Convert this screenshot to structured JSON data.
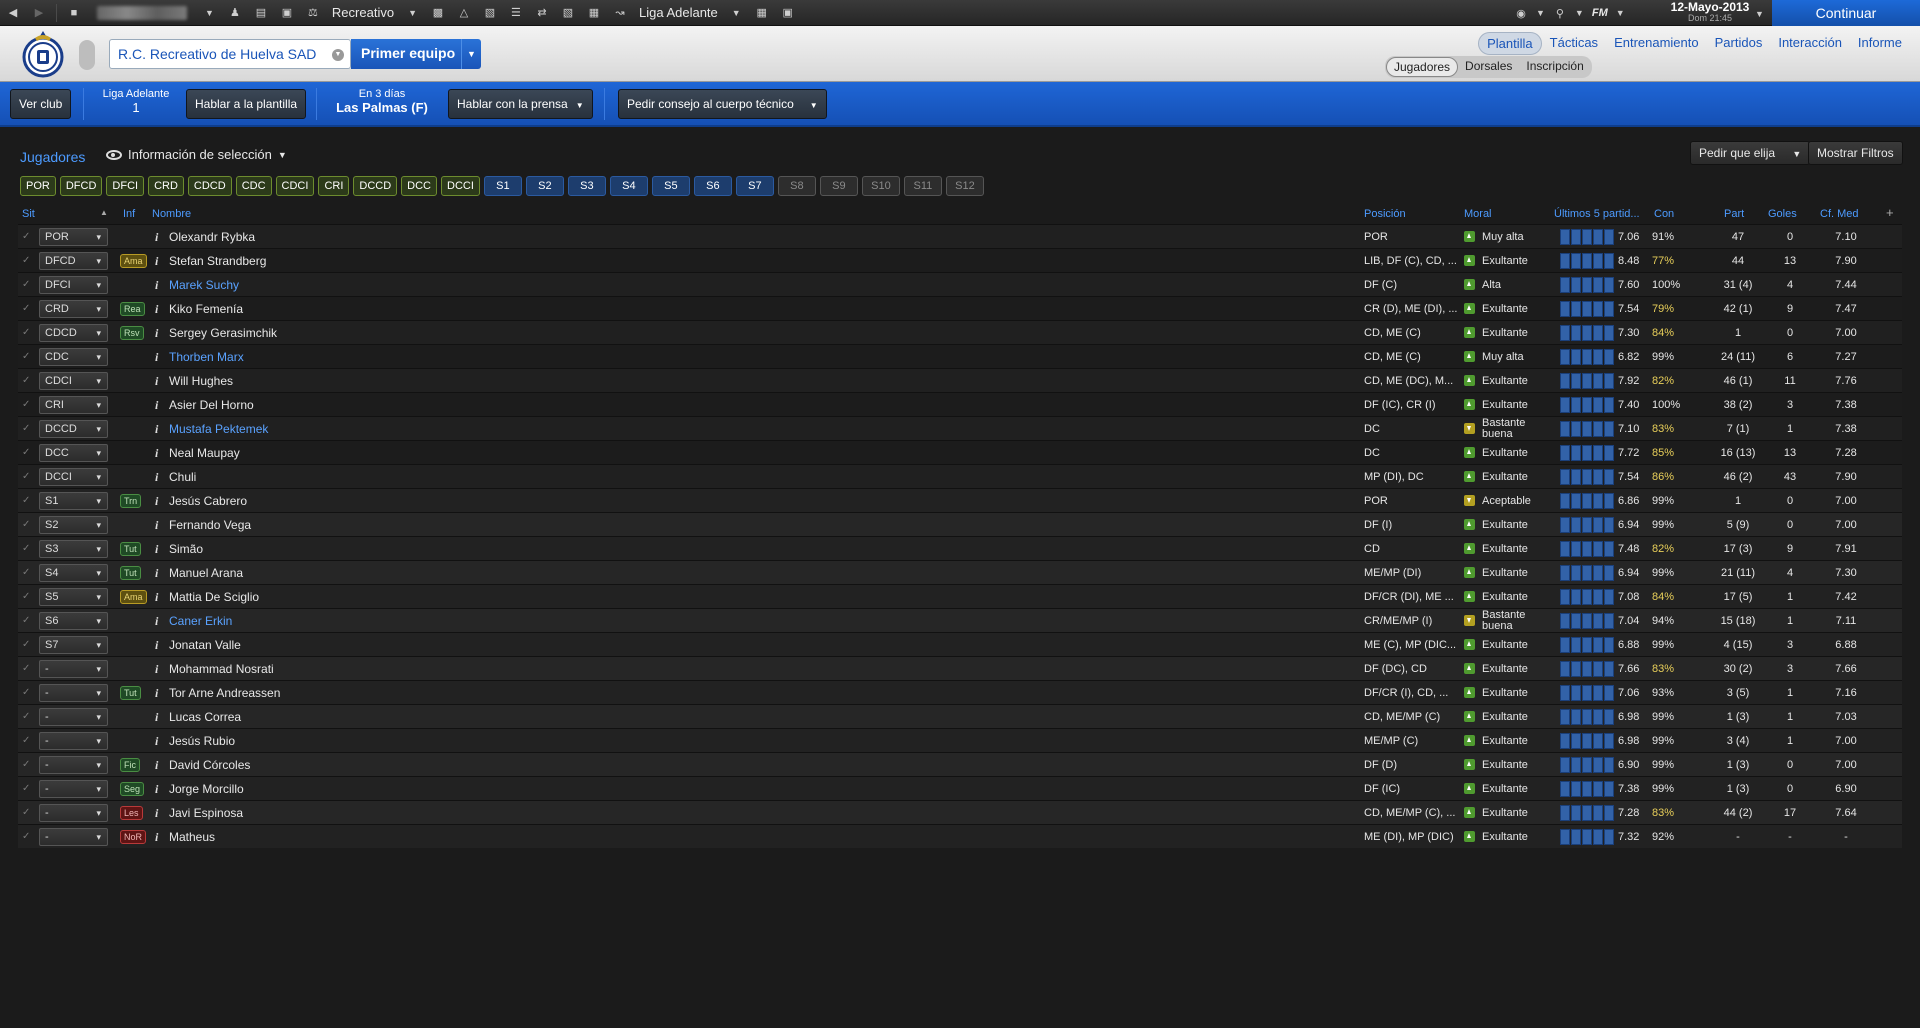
{
  "topbar": {
    "team_short": "Recreativo",
    "league": "Liga Adelante",
    "date": "12-Mayo-2013",
    "day_time": "Dom 21:45",
    "fm_label": "FM",
    "continue_label": "Continuar"
  },
  "header": {
    "club_name": "R.C. Recreativo de Huelva SAD",
    "team_button": "Primer equipo",
    "main_tabs": [
      "Plantilla",
      "Tácticas",
      "Entrenamiento",
      "Partidos",
      "Interacción",
      "Informe"
    ],
    "sub_tabs": [
      "Jugadores",
      "Dorsales",
      "Inscripción"
    ]
  },
  "actionbar": {
    "ver_club": "Ver club",
    "league_label": "Liga Adelante",
    "league_pos": "1",
    "talk_squad": "Hablar a la plantilla",
    "next_in": "En 3 días",
    "next_match": "Las Palmas (F)",
    "talk_press": "Hablar con la prensa",
    "ask_staff": "Pedir consejo al cuerpo técnico"
  },
  "panel": {
    "title": "Jugadores",
    "view": "Información de selección",
    "ask_choose": "Pedir que elija",
    "show_filters": "Mostrar Filtros"
  },
  "chips": {
    "positions": [
      "POR",
      "DFCD",
      "DFCI",
      "CRD",
      "CDCD",
      "CDC",
      "CDCI",
      "CRI",
      "DCCD",
      "DCC",
      "DCCI"
    ],
    "subs_active": [
      "S1",
      "S2",
      "S3",
      "S4",
      "S5",
      "S6",
      "S7"
    ],
    "subs_inactive": [
      "S8",
      "S9",
      "S10",
      "S11",
      "S12"
    ]
  },
  "columns": {
    "sit": "Sit",
    "inf": "Inf",
    "nombre": "Nombre",
    "posicion": "Posición",
    "moral": "Moral",
    "ultimos": "Últimos 5 partid...",
    "con": "Con",
    "part": "Part",
    "goles": "Goles",
    "cfmed": "Cf. Med",
    "add": "+"
  },
  "players": [
    {
      "sel": "POR",
      "inf": "",
      "name": "Olexandr Rybka",
      "link": false,
      "pos": "POR",
      "moral": "Muy alta",
      "mor": "up",
      "rate": "7.06",
      "con": "91%",
      "low": false,
      "part": "47",
      "goles": "0",
      "cf": "7.10"
    },
    {
      "sel": "DFCD",
      "inf": "Ama",
      "infc": "yellow",
      "name": "Stefan Strandberg",
      "link": false,
      "pos": "LIB, DF (C), CD, ...",
      "moral": "Exultante",
      "mor": "up",
      "rate": "8.48",
      "con": "77%",
      "low": true,
      "part": "44",
      "goles": "13",
      "cf": "7.90"
    },
    {
      "sel": "DFCI",
      "inf": "",
      "name": "Marek Suchy",
      "link": true,
      "pos": "DF (C)",
      "moral": "Alta",
      "mor": "up",
      "rate": "7.60",
      "con": "100%",
      "low": false,
      "part": "31 (4)",
      "goles": "4",
      "cf": "7.44"
    },
    {
      "sel": "CRD",
      "inf": "Rea",
      "infc": "green",
      "name": "Kiko Femenía",
      "link": false,
      "pos": "CR (D), ME (DI), ...",
      "moral": "Exultante",
      "mor": "up",
      "rate": "7.54",
      "con": "79%",
      "low": true,
      "part": "42 (1)",
      "goles": "9",
      "cf": "7.47"
    },
    {
      "sel": "CDCD",
      "inf": "Rsv",
      "infc": "green",
      "name": "Sergey Gerasimchik",
      "link": false,
      "pos": "CD, ME (C)",
      "moral": "Exultante",
      "mor": "up",
      "rate": "7.30",
      "con": "84%",
      "low": true,
      "part": "1",
      "goles": "0",
      "cf": "7.00"
    },
    {
      "sel": "CDC",
      "inf": "",
      "name": "Thorben Marx",
      "link": true,
      "pos": "CD, ME (C)",
      "moral": "Muy alta",
      "mor": "up",
      "rate": "6.82",
      "con": "99%",
      "low": false,
      "part": "24 (11)",
      "goles": "6",
      "cf": "7.27"
    },
    {
      "sel": "CDCI",
      "inf": "",
      "name": "Will Hughes",
      "link": false,
      "pos": "CD, ME (DC), M...",
      "moral": "Exultante",
      "mor": "up",
      "rate": "7.92",
      "con": "82%",
      "low": true,
      "part": "46 (1)",
      "goles": "11",
      "cf": "7.76"
    },
    {
      "sel": "CRI",
      "inf": "",
      "name": "Asier Del Horno",
      "link": false,
      "pos": "DF (IC), CR (I)",
      "moral": "Exultante",
      "mor": "up",
      "rate": "7.40",
      "con": "100%",
      "low": false,
      "part": "38 (2)",
      "goles": "3",
      "cf": "7.38"
    },
    {
      "sel": "DCCD",
      "inf": "",
      "name": "Mustafa Pektemek",
      "link": true,
      "pos": "DC",
      "moral": "Bastante buena",
      "mor": "down",
      "rate": "7.10",
      "con": "83%",
      "low": true,
      "part": "7 (1)",
      "goles": "1",
      "cf": "7.38"
    },
    {
      "sel": "DCC",
      "inf": "",
      "name": "Neal Maupay",
      "link": false,
      "pos": "DC",
      "moral": "Exultante",
      "mor": "up",
      "rate": "7.72",
      "con": "85%",
      "low": true,
      "part": "16 (13)",
      "goles": "13",
      "cf": "7.28"
    },
    {
      "sel": "DCCI",
      "inf": "",
      "name": "Chuli",
      "link": false,
      "pos": "MP (DI), DC",
      "moral": "Exultante",
      "mor": "up",
      "rate": "7.54",
      "con": "86%",
      "low": true,
      "part": "46 (2)",
      "goles": "43",
      "cf": "7.90"
    },
    {
      "sel": "S1",
      "inf": "Trn",
      "infc": "green",
      "name": "Jesús Cabrero",
      "link": false,
      "pos": "POR",
      "moral": "Aceptable",
      "mor": "flat",
      "rate": "6.86",
      "con": "99%",
      "low": false,
      "part": "1",
      "goles": "0",
      "cf": "7.00"
    },
    {
      "sel": "S2",
      "inf": "",
      "name": "Fernando Vega",
      "link": false,
      "pos": "DF (I)",
      "moral": "Exultante",
      "mor": "up",
      "rate": "6.94",
      "con": "99%",
      "low": false,
      "part": "5 (9)",
      "goles": "0",
      "cf": "7.00"
    },
    {
      "sel": "S3",
      "inf": "Tut",
      "infc": "green",
      "name": "Simão",
      "link": false,
      "pos": "CD",
      "moral": "Exultante",
      "mor": "up",
      "rate": "7.48",
      "con": "82%",
      "low": true,
      "part": "17 (3)",
      "goles": "9",
      "cf": "7.91"
    },
    {
      "sel": "S4",
      "inf": "Tut",
      "infc": "green",
      "name": "Manuel Arana",
      "link": false,
      "pos": "ME/MP (DI)",
      "moral": "Exultante",
      "mor": "up",
      "rate": "6.94",
      "con": "99%",
      "low": false,
      "part": "21 (11)",
      "goles": "4",
      "cf": "7.30"
    },
    {
      "sel": "S5",
      "inf": "Ama",
      "infc": "yellow",
      "name": "Mattia De Sciglio",
      "link": false,
      "pos": "DF/CR (DI), ME ...",
      "moral": "Exultante",
      "mor": "up",
      "rate": "7.08",
      "con": "84%",
      "low": true,
      "part": "17 (5)",
      "goles": "1",
      "cf": "7.42"
    },
    {
      "sel": "S6",
      "inf": "",
      "name": "Caner Erkin",
      "link": true,
      "pos": "CR/ME/MP (I)",
      "moral": "Bastante buena",
      "mor": "down",
      "rate": "7.04",
      "con": "94%",
      "low": false,
      "part": "15 (18)",
      "goles": "1",
      "cf": "7.11"
    },
    {
      "sel": "S7",
      "inf": "",
      "name": "Jonatan Valle",
      "link": false,
      "pos": "ME (C), MP (DIC...",
      "moral": "Exultante",
      "mor": "up",
      "rate": "6.88",
      "con": "99%",
      "low": false,
      "part": "4 (15)",
      "goles": "3",
      "cf": "6.88"
    },
    {
      "sel": "-",
      "inf": "",
      "name": "Mohammad Nosrati",
      "link": false,
      "pos": "DF (DC), CD",
      "moral": "Exultante",
      "mor": "up",
      "rate": "7.66",
      "con": "83%",
      "low": true,
      "part": "30 (2)",
      "goles": "3",
      "cf": "7.66"
    },
    {
      "sel": "-",
      "inf": "Tut",
      "infc": "green",
      "name": "Tor Arne Andreassen",
      "link": false,
      "pos": "DF/CR (I), CD, ...",
      "moral": "Exultante",
      "mor": "up",
      "rate": "7.06",
      "con": "93%",
      "low": false,
      "part": "3 (5)",
      "goles": "1",
      "cf": "7.16"
    },
    {
      "sel": "-",
      "inf": "",
      "name": "Lucas Correa",
      "link": false,
      "pos": "CD, ME/MP (C)",
      "moral": "Exultante",
      "mor": "up",
      "rate": "6.98",
      "con": "99%",
      "low": false,
      "part": "1 (3)",
      "goles": "1",
      "cf": "7.03"
    },
    {
      "sel": "-",
      "inf": "",
      "name": "Jesús Rubio",
      "link": false,
      "pos": "ME/MP (C)",
      "moral": "Exultante",
      "mor": "up",
      "rate": "6.98",
      "con": "99%",
      "low": false,
      "part": "3 (4)",
      "goles": "1",
      "cf": "7.00"
    },
    {
      "sel": "-",
      "inf": "Fic",
      "infc": "green",
      "name": "David Córcoles",
      "link": false,
      "pos": "DF (D)",
      "moral": "Exultante",
      "mor": "up",
      "rate": "6.90",
      "con": "99%",
      "low": false,
      "part": "1 (3)",
      "goles": "0",
      "cf": "7.00"
    },
    {
      "sel": "-",
      "inf": "Seg",
      "infc": "green",
      "name": "Jorge Morcillo",
      "link": false,
      "pos": "DF (IC)",
      "moral": "Exultante",
      "mor": "up",
      "rate": "7.38",
      "con": "99%",
      "low": false,
      "part": "1 (3)",
      "goles": "0",
      "cf": "6.90"
    },
    {
      "sel": "-",
      "inf": "Les",
      "infc": "red",
      "name": "Javi Espinosa",
      "link": false,
      "pos": "CD, ME/MP (C), ...",
      "moral": "Exultante",
      "mor": "up",
      "rate": "7.28",
      "con": "83%",
      "low": true,
      "part": "44 (2)",
      "goles": "17",
      "cf": "7.64"
    },
    {
      "sel": "-",
      "inf": "NoR",
      "infc": "red",
      "name": "Matheus",
      "link": false,
      "pos": "ME (DI), MP (DIC)",
      "moral": "Exultante",
      "mor": "up",
      "rate": "7.32",
      "con": "92%",
      "low": false,
      "part": "-",
      "goles": "-",
      "cf": "-"
    }
  ]
}
